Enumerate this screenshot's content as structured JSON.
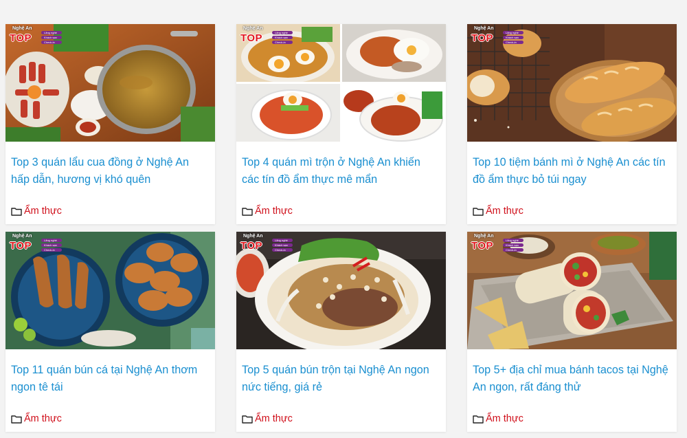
{
  "badge": {
    "logo_text": "TOP",
    "region_text": "Nghệ An",
    "pills": [
      "Lãng nghề",
      "Khách sạn",
      "Check-in"
    ]
  },
  "category_icon": "folder-icon",
  "colors": {
    "title_link": "#1a8fd0",
    "category_link": "#d0101b",
    "badge_red": "#e2161d",
    "badge_purple": "#7b2a8e"
  },
  "posts": [
    {
      "title": "Top 3 quán lẩu cua đồng ở Nghệ An hấp dẫn, hương vị khó quên",
      "category": "Ẩm thực"
    },
    {
      "title": "Top 4 quán mì trộn ở Nghệ An khiến các tín đồ ẩm thực mê mẩn",
      "category": "Ẩm thực"
    },
    {
      "title": "Top 10 tiệm bánh mì ở Nghệ An các tín đồ ẩm thực bỏ túi ngay",
      "category": "Ẩm thực"
    },
    {
      "title": "Top 11 quán bún cá tại Nghệ An thơm ngon tê tái",
      "category": "Ẩm thực"
    },
    {
      "title": "Top 5 quán bún trộn tại Nghệ An ngon nức tiếng, giá rẻ",
      "category": "Ẩm thực"
    },
    {
      "title": "Top 5+ địa chỉ mua bánh tacos tại Nghệ An ngon, rất đáng thử",
      "category": "Ẩm thực"
    }
  ]
}
